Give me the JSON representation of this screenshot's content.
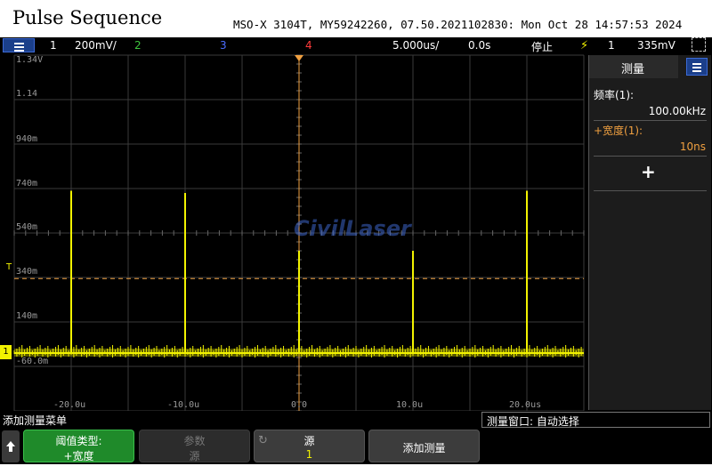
{
  "header": {
    "title": "Pulse Sequence",
    "instrument_info": "MSO-X 3104T, MY59242260, 07.50.2021102830: Mon Oct 28 14:57:53 2024"
  },
  "statusbar": {
    "ch1_num": "1",
    "ch1_scale": "200mV/",
    "ch2_num": "2",
    "ch3_num": "3",
    "ch4_num": "4",
    "timebase": "5.000us/",
    "delay": "0.0s",
    "run_state": "停止",
    "trigger_source": "1",
    "trigger_level": "335mV",
    "colors": {
      "ch1": "#f2f200",
      "ch2": "#3ec43e",
      "ch3": "#4a6cff",
      "ch4": "#ff3b3b",
      "trigger_icon": "#f2f200"
    }
  },
  "display": {
    "y_labels": [
      "1.34V",
      "1.14",
      "940m",
      "740m",
      "540m",
      "340m",
      "140m",
      "-60.0m"
    ],
    "x_labels": [
      "-20.0u",
      "-10.0u",
      "0.0",
      "10.0u",
      "20.0us"
    ],
    "ground_marker": "1",
    "trigger_marker": "T",
    "watermark": "CivilLaser",
    "trace": {
      "color": "#f2f200",
      "baseline_v": -0.0,
      "pulse_times_us": [
        -20,
        -10,
        0,
        10,
        20
      ],
      "pulse_peaks_v": [
        0.73,
        0.72,
        0.46,
        0.46,
        0.73
      ],
      "trigger_level_v": 0.335
    }
  },
  "measurements": {
    "title": "测量",
    "items": [
      {
        "label": "频率(1):",
        "value": "100.00kHz",
        "color": "#ffffff"
      },
      {
        "label": "+宽度(1):",
        "value": "10ns",
        "color": "#f0a040"
      }
    ],
    "add_symbol": "+"
  },
  "softkeys": {
    "menu_title": "添加测量菜单",
    "window_label": "测量窗口: 自动选择",
    "up_icon": "arrow-up-icon",
    "keys": [
      {
        "l1": "阈值类型:",
        "l2": "+宽度"
      },
      {
        "l1": "参数",
        "l2": "源"
      },
      {
        "l1": "源",
        "l2": "1"
      },
      {
        "l1": "添加测量",
        "l2": ""
      }
    ]
  }
}
